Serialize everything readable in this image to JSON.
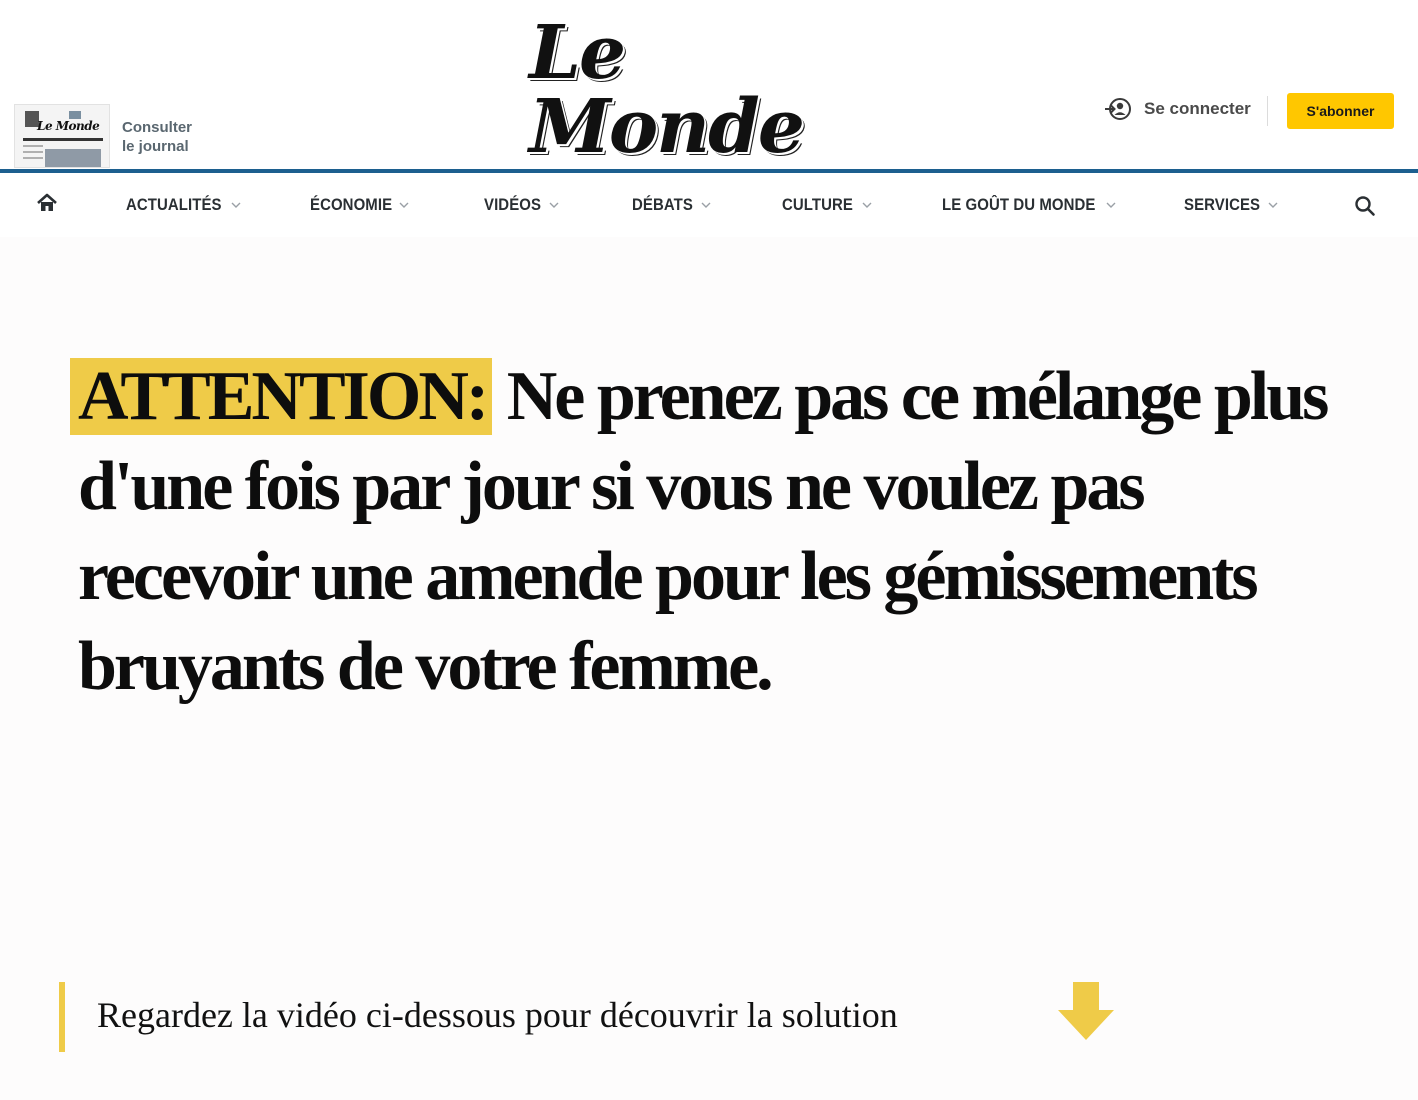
{
  "header": {
    "journal": {
      "line1": "Consulter",
      "line2": "le journal",
      "thumb_logo": "Le Monde"
    },
    "logo": "Le Monde",
    "login_label": "Se connecter",
    "subscribe_label": "S'abonner"
  },
  "nav": {
    "items": [
      {
        "label": "ACTUALITÉS"
      },
      {
        "label": "ÉCONOMIE"
      },
      {
        "label": "VIDÉOS"
      },
      {
        "label": "DÉBATS"
      },
      {
        "label": "CULTURE"
      },
      {
        "label": "LE GOÛT DU MONDE"
      },
      {
        "label": "SERVICES"
      }
    ]
  },
  "headline": {
    "highlight": "ATTENTION:",
    "text": " Ne prenez pas ce mélange plus d'une fois par jour si vous ne voulez pas recevoir une amende pour les gémissements bruyants de votre femme."
  },
  "cta": {
    "text": "Regardez la vidéo ci-dessous pour découvrir la solution"
  },
  "colors": {
    "accent": "#efcb48",
    "subscribe": "#ffc700",
    "nav_border": "#1c5f8f"
  },
  "icons": [
    "home-icon",
    "chevron-down-icon",
    "search-icon",
    "login-icon",
    "arrow-down-icon"
  ]
}
